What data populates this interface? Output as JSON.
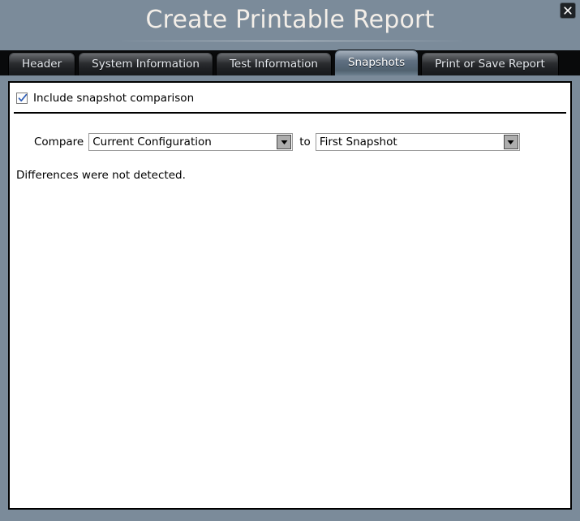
{
  "window": {
    "title": "Create Printable Report",
    "close_icon": "close-x-icon",
    "background_color": "#7b8b9a",
    "panel_background": "#ffffff"
  },
  "tabs": [
    {
      "label": "Header",
      "active": false
    },
    {
      "label": "System Information",
      "active": false
    },
    {
      "label": "Test Information",
      "active": false
    },
    {
      "label": "Snapshots",
      "active": true
    },
    {
      "label": "Print or Save Report",
      "active": false
    }
  ],
  "panel": {
    "include_snapshot": {
      "label": "Include snapshot comparison",
      "checked": true,
      "check_icon": "checkmark-icon",
      "check_color": "#2b5bb5"
    },
    "compare_row": {
      "prefix_label": "Compare",
      "middle_label": "to",
      "source_combo": {
        "value": "Current Configuration",
        "arrow_icon": "chevron-down-icon"
      },
      "target_combo": {
        "value": "First Snapshot",
        "arrow_icon": "chevron-down-icon"
      }
    },
    "status_text": "Differences were not detected."
  }
}
